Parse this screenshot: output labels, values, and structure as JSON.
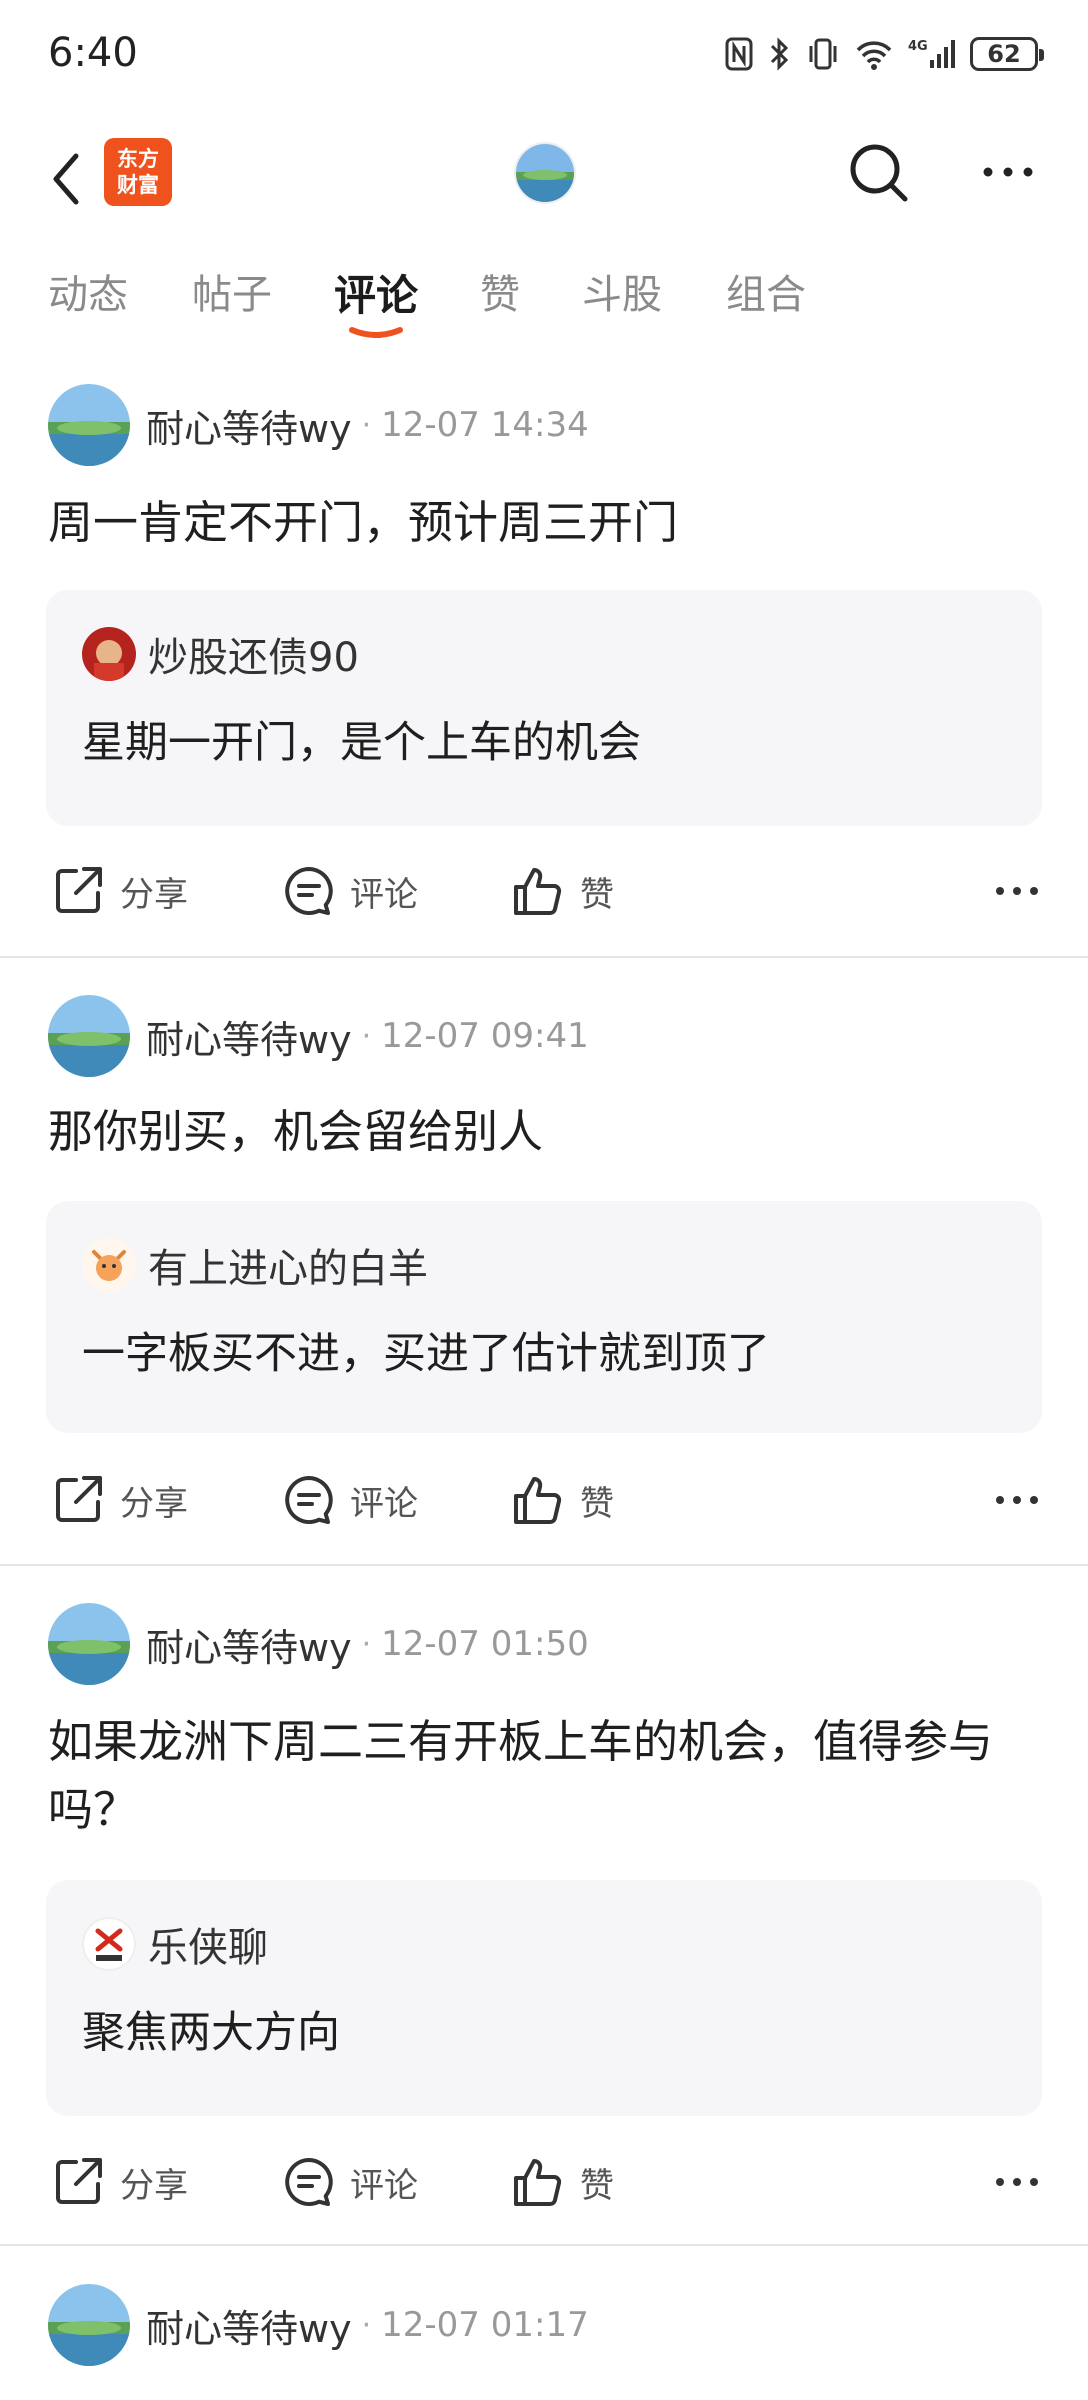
{
  "status_bar": {
    "time": "6:40",
    "battery": "62"
  },
  "header": {
    "logo_line1": "东方",
    "logo_line2": "财富"
  },
  "tabs": [
    {
      "label": "动态"
    },
    {
      "label": "帖子"
    },
    {
      "label": "评论"
    },
    {
      "label": "赞"
    },
    {
      "label": "斗股"
    },
    {
      "label": "组合"
    }
  ],
  "active_tab": "评论",
  "accent_color": "#f0521e",
  "actions": {
    "share": "分享",
    "comment": "评论",
    "like": "赞"
  },
  "posts": [
    {
      "author": "耐心等待wy",
      "time": "12-07 14:34",
      "content": "周一肯定不开门，预计周三开门",
      "quote": {
        "name": "炒股还债90",
        "text": "星期一开门，是个上车的机会"
      }
    },
    {
      "author": "耐心等待wy",
      "time": "12-07 09:41",
      "content": "那你别买，机会留给别人",
      "quote": {
        "name": "有上进心的白羊",
        "text": "一字板买不进，买进了估计就到顶了"
      }
    },
    {
      "author": "耐心等待wy",
      "time": "12-07 01:50",
      "content": "如果龙洲下周二三有开板上车的机会，值得参与吗？",
      "quote": {
        "name": "乐侠聊",
        "text": "聚焦两大方向"
      }
    },
    {
      "author": "耐心等待wy",
      "time": "12-07 01:17"
    }
  ]
}
